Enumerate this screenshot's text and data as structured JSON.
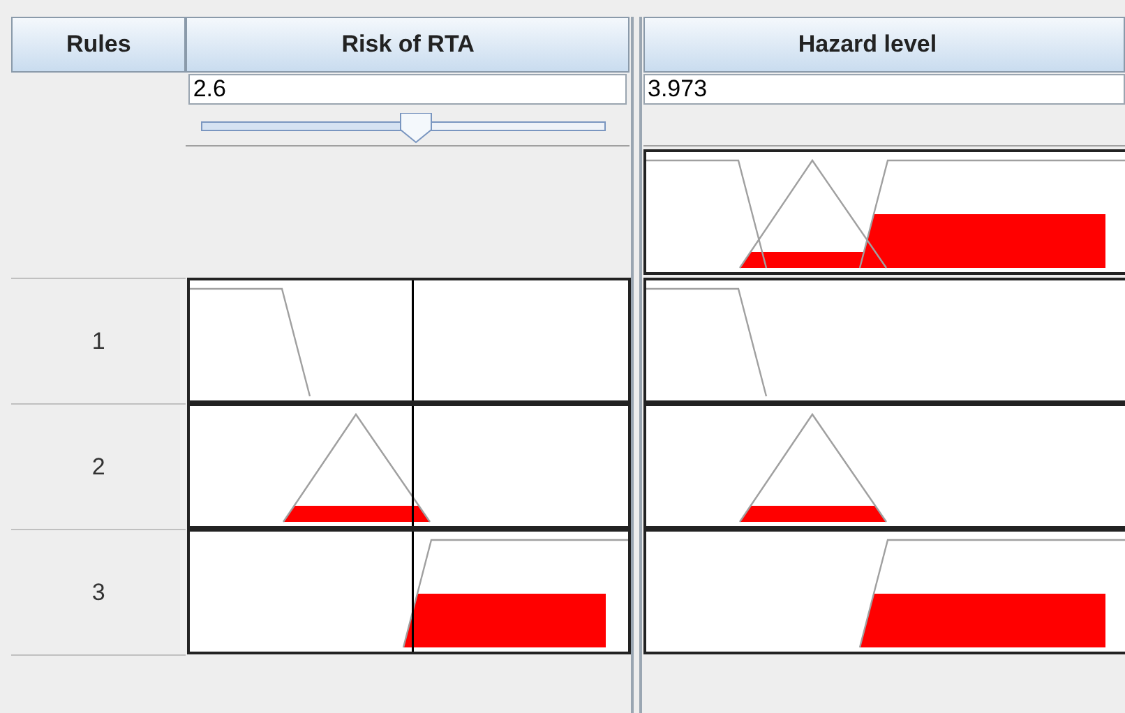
{
  "columns": [
    {
      "label": "Rules"
    },
    {
      "label": "Risk of RTA"
    },
    {
      "label": "Hazard level"
    }
  ],
  "input": {
    "value": "2.6",
    "level": 0.53
  },
  "output": {
    "value": "3.973"
  },
  "rules": [
    {
      "number": "1",
      "input": {
        "kind": "left"
      },
      "output": {
        "kind": "left"
      }
    },
    {
      "number": "2",
      "input": {
        "kind": "triangle"
      },
      "output": {
        "kind": "triangle"
      }
    },
    {
      "number": "3",
      "input": {
        "kind": "right"
      },
      "output": {
        "kind": "right"
      }
    }
  ]
}
